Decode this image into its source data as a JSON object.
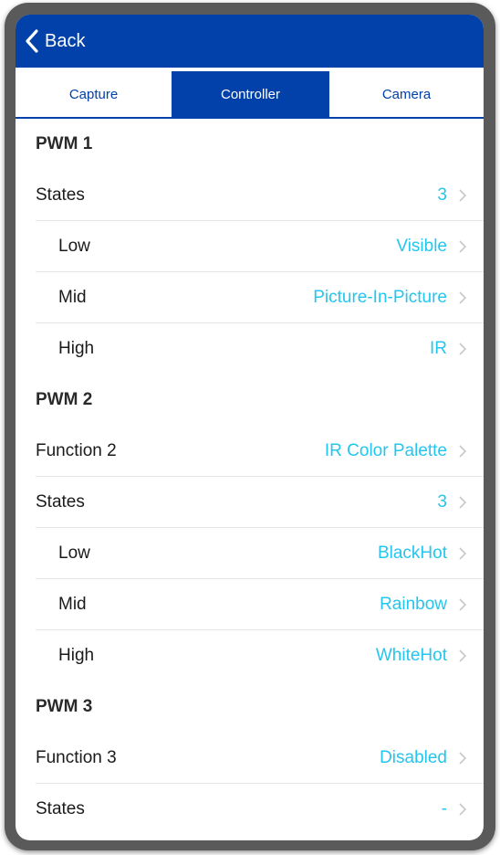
{
  "nav": {
    "back_label": "Back"
  },
  "tabs": [
    {
      "label": "Capture",
      "active": false
    },
    {
      "label": "Controller",
      "active": true
    },
    {
      "label": "Camera",
      "active": false
    }
  ],
  "sections": [
    {
      "title": "PWM 1",
      "rows": [
        {
          "label": "States",
          "value": "3"
        },
        {
          "label": "Low",
          "value": "Visible"
        },
        {
          "label": "Mid",
          "value": "Picture-In-Picture"
        },
        {
          "label": "High",
          "value": "IR"
        }
      ]
    },
    {
      "title": "PWM 2",
      "rows": [
        {
          "label": "Function 2",
          "value": "IR Color Palette"
        },
        {
          "label": "States",
          "value": "3"
        },
        {
          "label": "Low",
          "value": "BlackHot"
        },
        {
          "label": "Mid",
          "value": "Rainbow"
        },
        {
          "label": "High",
          "value": "WhiteHot"
        }
      ]
    },
    {
      "title": "PWM 3",
      "rows": [
        {
          "label": "Function 3",
          "value": "Disabled"
        },
        {
          "label": "States",
          "value": "-"
        }
      ]
    }
  ],
  "colors": {
    "brand": "#0141a9",
    "value": "#23c6ee",
    "chevron": "#c7c7cc"
  },
  "icons": {
    "back": "chevron-left-icon",
    "row": "chevron-right-icon"
  }
}
